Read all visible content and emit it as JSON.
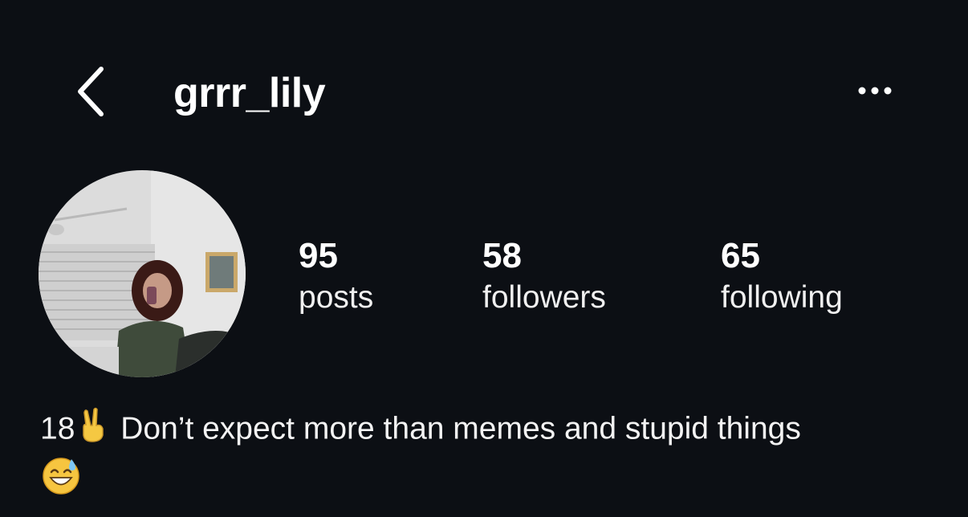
{
  "header": {
    "back_icon": "chevron-left-icon",
    "username": "grrr_lily",
    "more_icon": "ellipsis-icon"
  },
  "profile": {
    "avatar_desc": "profile-photo",
    "stats": [
      {
        "value": "95",
        "label": "posts"
      },
      {
        "value": "58",
        "label": "followers"
      },
      {
        "value": "65",
        "label": "following"
      }
    ]
  },
  "bio": {
    "age": "18",
    "emoji_1": "victory-hand-emoji",
    "text": "Don’t expect more than memes and stupid things",
    "emoji_2": "grinning-sweat-emoji"
  },
  "colors": {
    "background": "#0c0f14",
    "text": "#ffffff"
  }
}
